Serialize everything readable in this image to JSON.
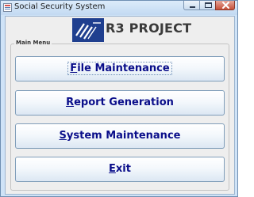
{
  "window": {
    "title": "Social Security System",
    "controls": [
      "minimize-icon",
      "maximize-icon",
      "close-icon"
    ]
  },
  "header": {
    "logo_icon": "sss-logo-icon",
    "logo_text": "R3 PROJECT"
  },
  "menu": {
    "label": "Main Menu",
    "focused_index": 0,
    "buttons": [
      {
        "mnemonic": "F",
        "rest": "ile Maintenance"
      },
      {
        "mnemonic": "R",
        "rest": "eport Generation"
      },
      {
        "mnemonic": "S",
        "rest": "ystem Maintenance"
      },
      {
        "mnemonic": "E",
        "rest": "xit"
      }
    ]
  },
  "colors": {
    "button_text": "#0a0e8a",
    "window_frame": "#cfe3f7",
    "close_button": "#c64f38"
  }
}
